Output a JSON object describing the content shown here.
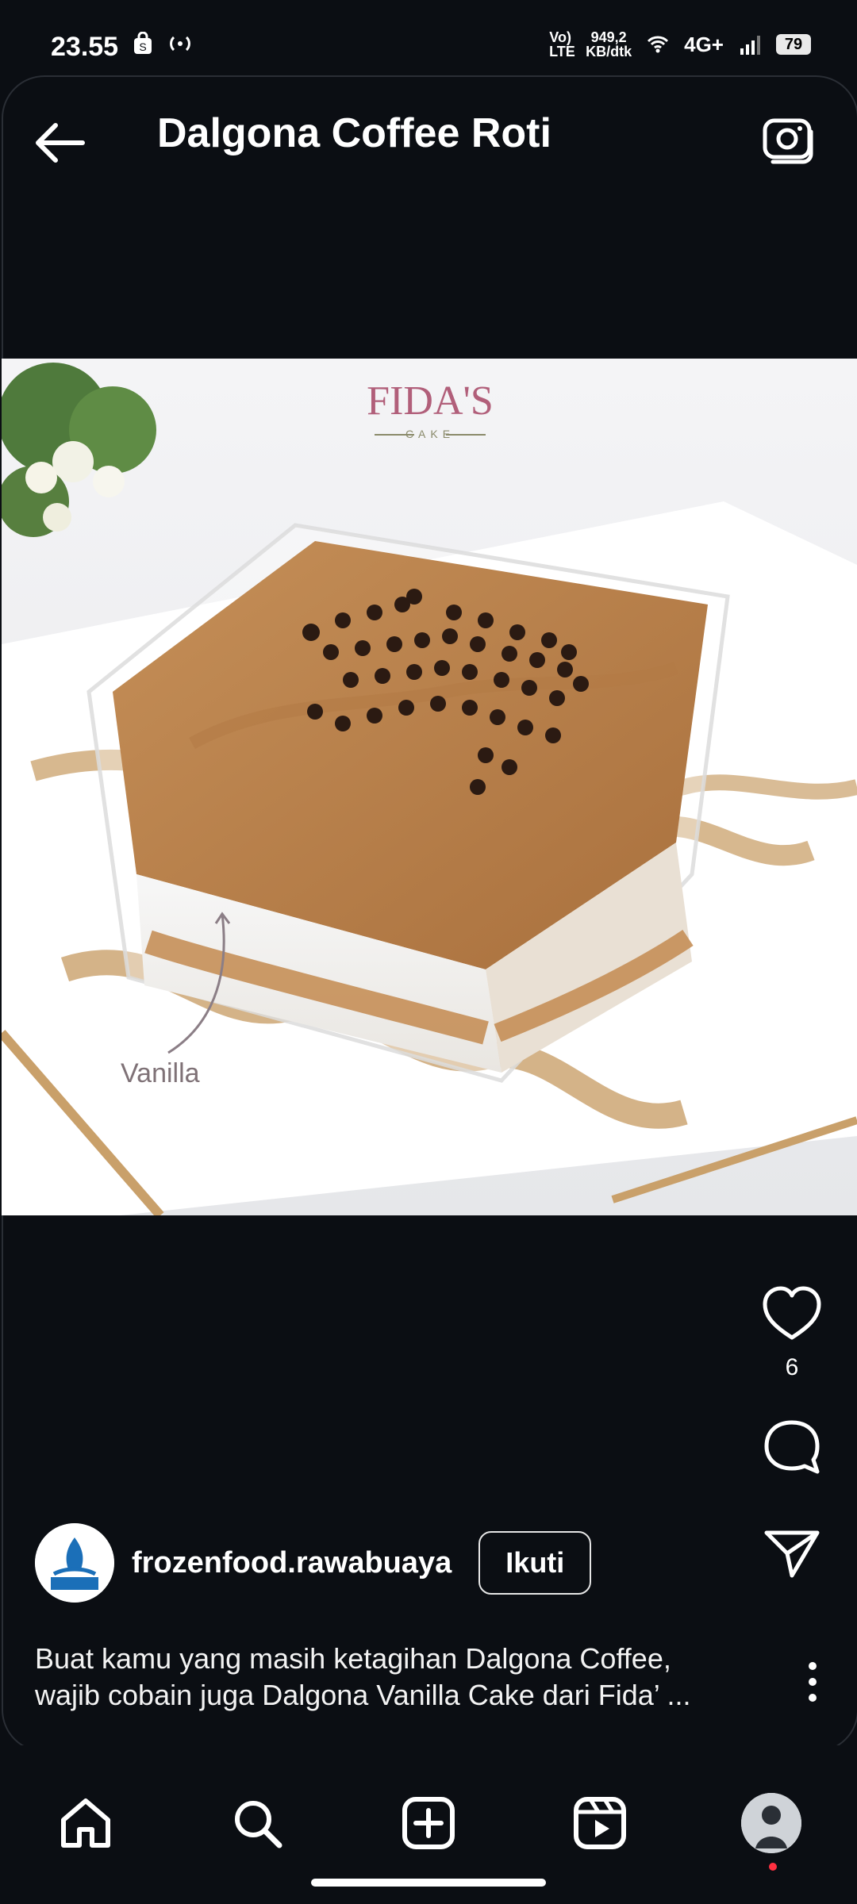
{
  "status": {
    "time": "23.55",
    "network_speed": "949,2\nKB/dtk",
    "network_label": "4G+",
    "battery": "79",
    "volte": "Vo) LTE"
  },
  "header": {
    "title": "Dalgona Coffee Roti"
  },
  "hero": {
    "brand": "FIDA'S",
    "brand_sub": "CAKE",
    "annotation": "Vanilla"
  },
  "post": {
    "likes_count": "6",
    "username": "frozenfood.rawabuaya",
    "follow_label": "Ikuti",
    "caption_line1": "Buat kamu yang masih ketagihan Dalgona Coffee,",
    "caption_line2": "wajib cobain juga Dalgona Vanilla Cake dari Fida’ ..."
  },
  "nav": {
    "items": [
      "home",
      "search",
      "create",
      "reels",
      "profile"
    ]
  }
}
